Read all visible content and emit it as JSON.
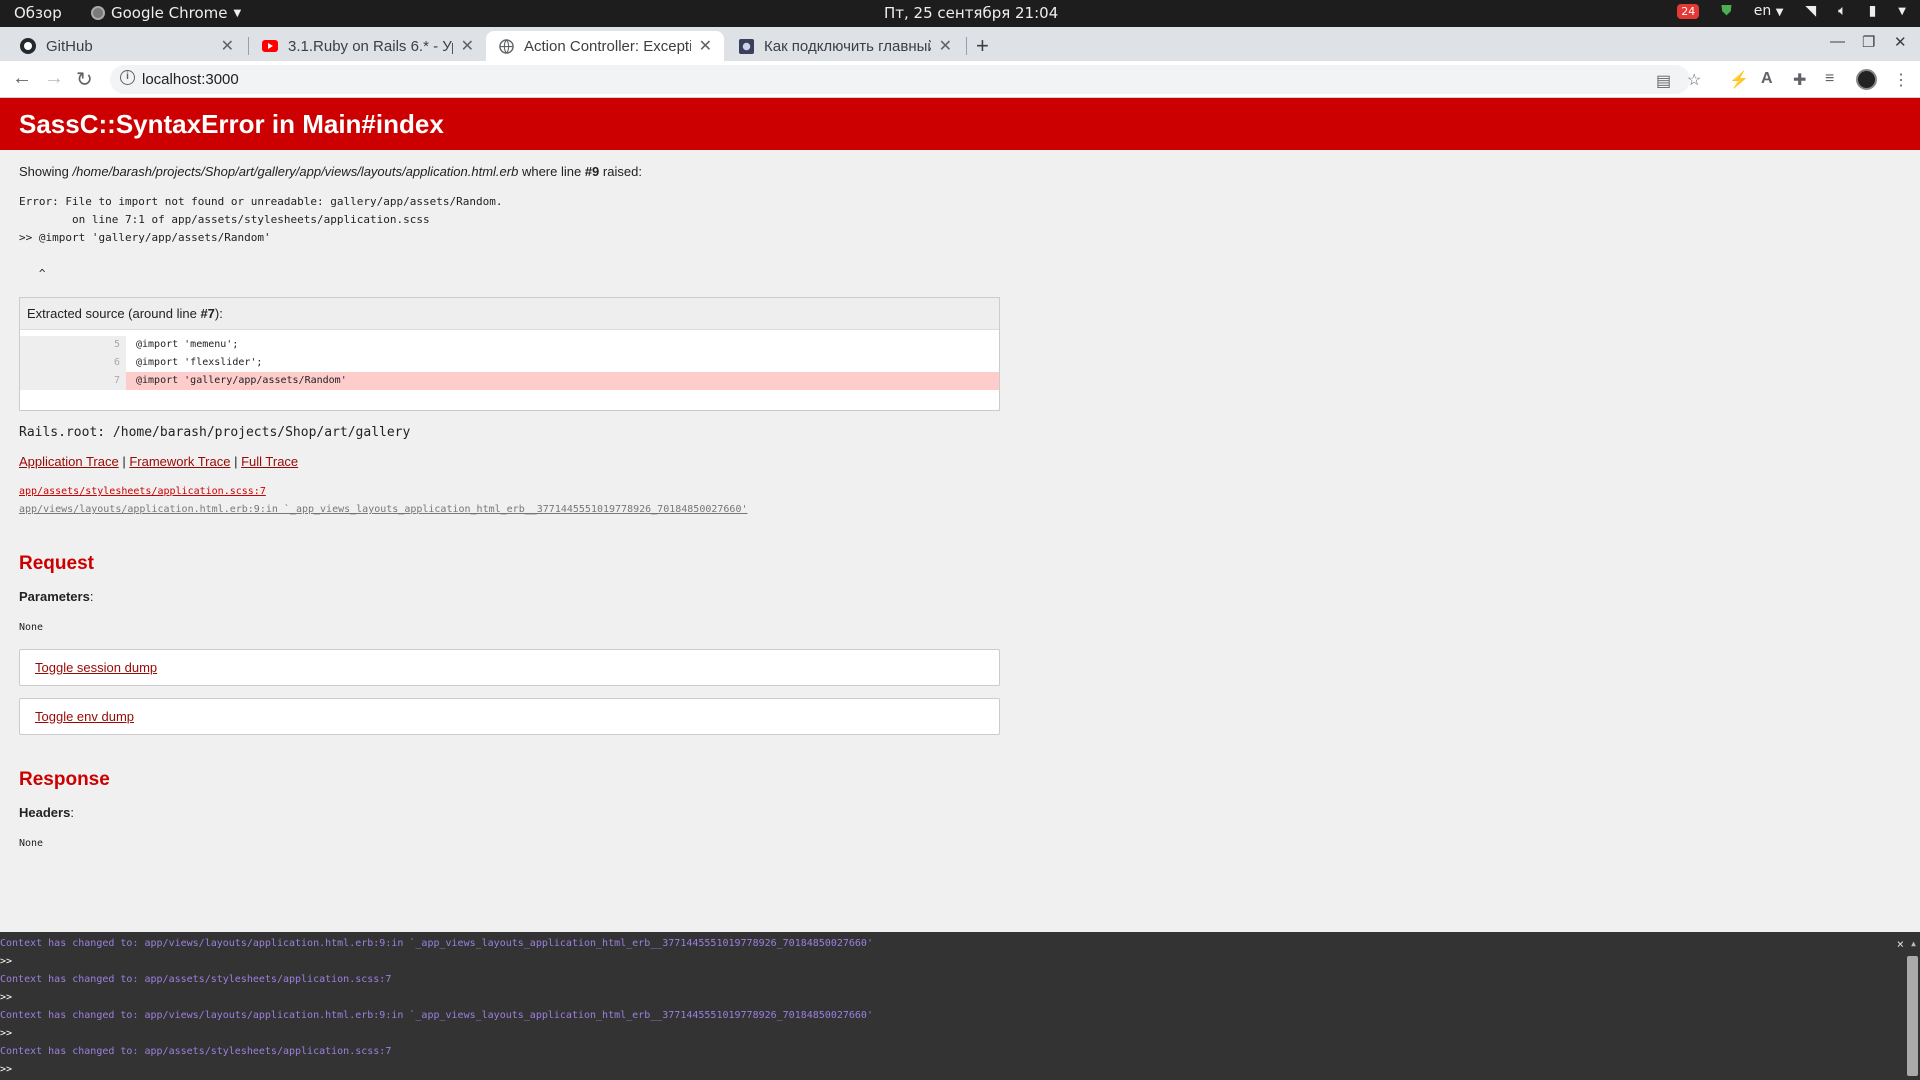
{
  "topbar": {
    "activities": "Обзор",
    "app_name": "Google Chrome",
    "clock": "Пт, 25 сентября  21:04",
    "notif_count": "24",
    "lang": "en"
  },
  "tabs": [
    {
      "title": "GitHub"
    },
    {
      "title": "3.1.Ruby on Rails 6.* - Уро"
    },
    {
      "title": "Action Controller: Excepti"
    },
    {
      "title": "Как подключить главный"
    }
  ],
  "address_bar": {
    "url": "localhost:3000"
  },
  "error": {
    "heading": "SassC::SyntaxError in Main#index",
    "showing_prefix": "Showing ",
    "showing_path": "/home/barash/projects/Shop/art/gallery/app/views/layouts/application.html.erb",
    "showing_mid": " where line ",
    "showing_line": "#9",
    "showing_suffix": " raised:",
    "message": "Error: File to import not found or unreadable: gallery/app/assets/Random.\n        on line 7:1 of app/assets/stylesheets/application.scss\n>> @import 'gallery/app/assets/Random'\n\n   ^"
  },
  "source": {
    "heading_prefix": "Extracted source (around line ",
    "heading_line": "#7",
    "heading_suffix": "):",
    "lines": [
      {
        "num": "5",
        "code": "@import 'memenu';"
      },
      {
        "num": "6",
        "code": "@import 'flexslider';"
      },
      {
        "num": "7",
        "code": "@import 'gallery/app/assets/Random'"
      }
    ]
  },
  "rails_root": "Rails.root: /home/barash/projects/Shop/art/gallery",
  "traces": {
    "application": "Application Trace",
    "framework": "Framework Trace",
    "full": "Full Trace",
    "sep": " | ",
    "lines": [
      "app/assets/stylesheets/application.scss:7",
      "app/views/layouts/application.html.erb:9:in `_app_views_layouts_application_html_erb__3771445551019778926_70184850027660'"
    ]
  },
  "request": {
    "heading": "Request",
    "params_label": "Parameters",
    "params_value": "None",
    "toggle_session": "Toggle session dump",
    "toggle_env": "Toggle env dump"
  },
  "response": {
    "heading": "Response",
    "headers_label": "Headers",
    "headers_value": "None"
  },
  "console": {
    "close": "×",
    "rows": [
      {
        "kind": "ctx",
        "text": "Context has changed to: app/views/layouts/application.html.erb:9:in `_app_views_layouts_application_html_erb__3771445551019778926_70184850027660'"
      },
      {
        "kind": "prompt",
        "text": ">>"
      },
      {
        "kind": "ctx",
        "text": "Context has changed to: app/assets/stylesheets/application.scss:7"
      },
      {
        "kind": "prompt",
        "text": ">>"
      },
      {
        "kind": "ctx",
        "text": "Context has changed to: app/views/layouts/application.html.erb:9:in `_app_views_layouts_application_html_erb__3771445551019778926_70184850027660'"
      },
      {
        "kind": "prompt",
        "text": ">>"
      },
      {
        "kind": "ctx",
        "text": "Context has changed to: app/assets/stylesheets/application.scss:7"
      },
      {
        "kind": "prompt",
        "text": ">>"
      }
    ]
  },
  "colors": {
    "error_red": "#cc0000",
    "link": "#980905",
    "console_bg": "#333333",
    "console_ctx": "#9b80e0"
  }
}
